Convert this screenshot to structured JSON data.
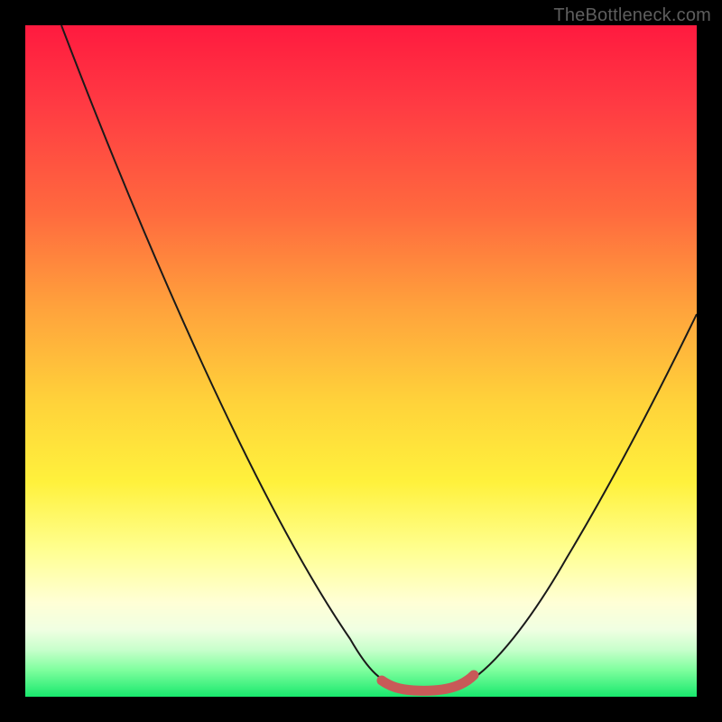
{
  "watermark": "TheBottleneck.com",
  "colors": {
    "background": "#000000",
    "gradient_top": "#ff1a3f",
    "gradient_bottom": "#18e86d",
    "curve": "#1a1a1a",
    "marker": "#c85a58",
    "watermark_text": "#5e5e5e"
  },
  "chart_data": {
    "type": "line",
    "title": "",
    "xlabel": "",
    "ylabel": "",
    "xlim": [
      0,
      100
    ],
    "ylim": [
      0,
      100
    ],
    "grid": false,
    "legend": false,
    "series": [
      {
        "name": "bottleneck-curve",
        "x": [
          5,
          10,
          15,
          20,
          25,
          30,
          35,
          40,
          45,
          50,
          53,
          55,
          58,
          60,
          62,
          65,
          70,
          75,
          80,
          85,
          90,
          95,
          100
        ],
        "y": [
          100,
          90,
          80,
          70,
          60,
          50,
          41,
          32,
          24,
          15,
          9,
          5,
          2,
          1,
          1,
          2,
          7,
          15,
          24,
          34,
          44,
          54,
          63
        ]
      }
    ],
    "annotations": [
      {
        "name": "optimal-band",
        "x_start": 53,
        "x_end": 66,
        "y": 1
      }
    ]
  }
}
